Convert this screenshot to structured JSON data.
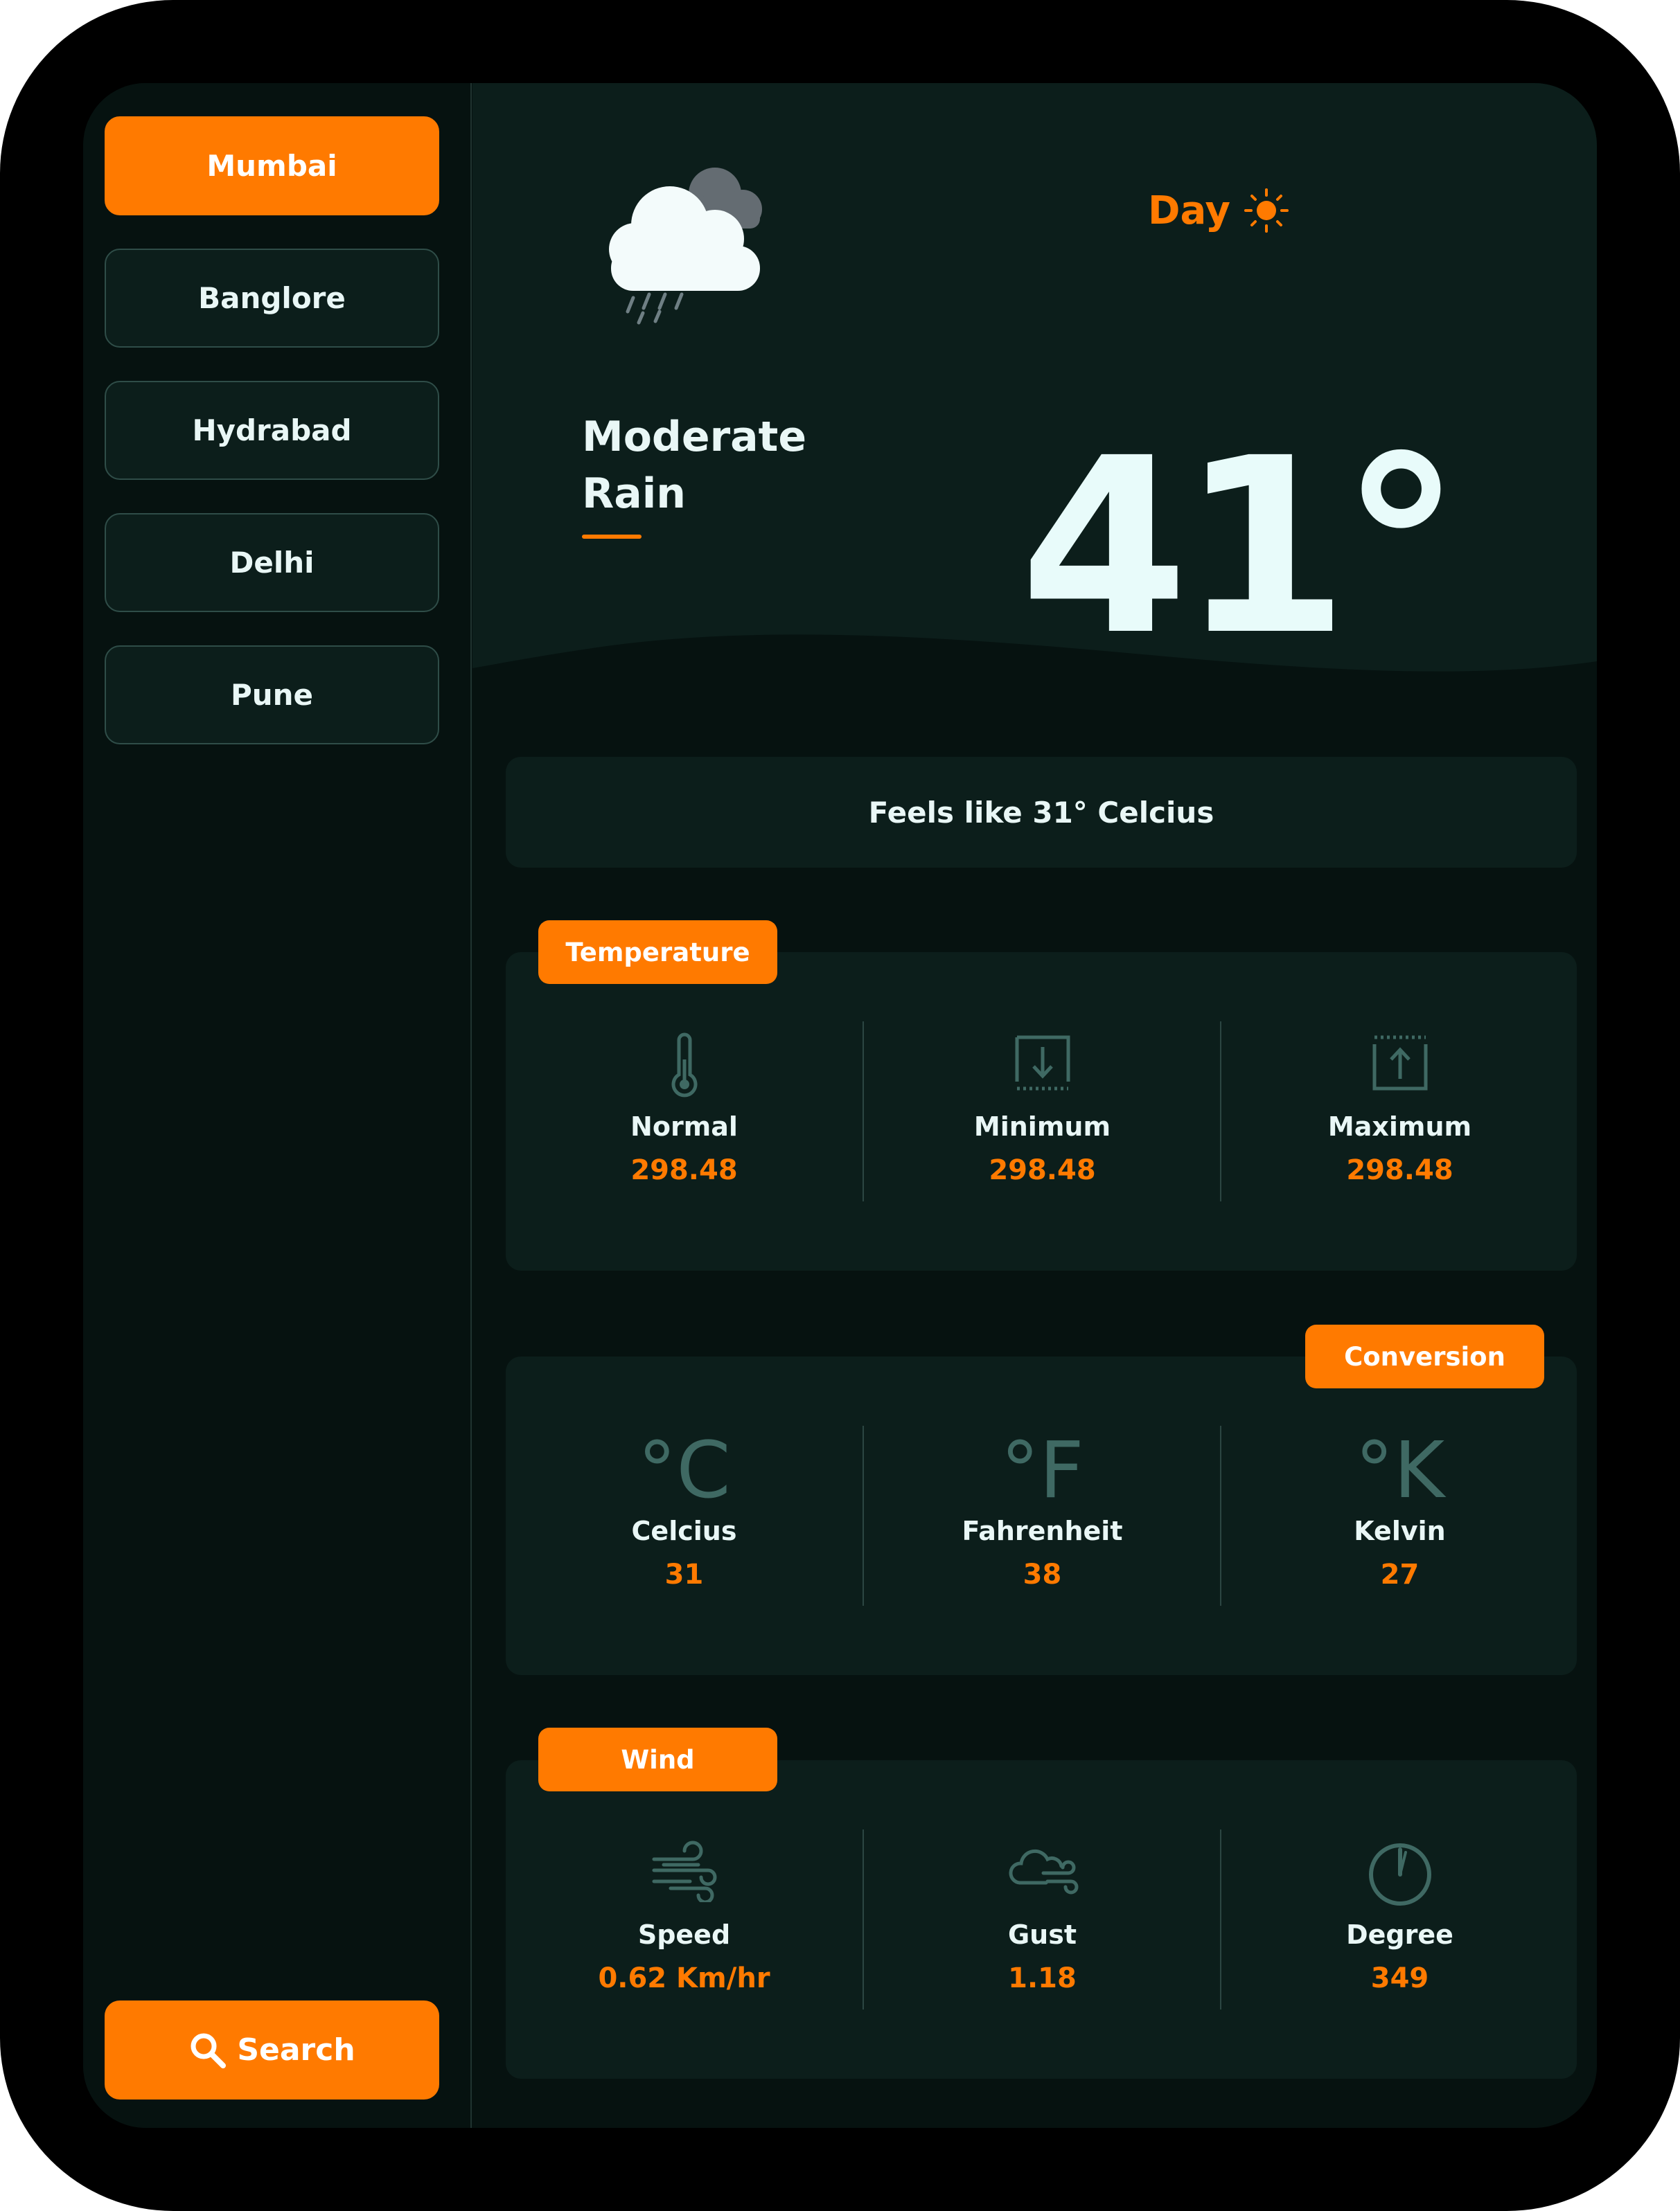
{
  "sidebar": {
    "cities": [
      "Mumbai",
      "Banglore",
      "Hydrabad",
      "Delhi",
      "Pune"
    ],
    "active_city": "Mumbai",
    "search_label": "Search"
  },
  "hero": {
    "period": "Day",
    "condition_line1": "Moderate",
    "condition_line2": "Rain",
    "temperature": "41°",
    "icons": {
      "weather": "cloud-rain-icon",
      "period": "sun-icon"
    }
  },
  "feels_like": "Feels like 31° Celcius",
  "temperature_panel": {
    "tag": "Temperature",
    "items": [
      {
        "label": "Normal",
        "value": "298.48",
        "icon": "thermometer-icon"
      },
      {
        "label": "Minimum",
        "value": "298.48",
        "icon": "min-arrow-icon"
      },
      {
        "label": "Maximum",
        "value": "298.48",
        "icon": "max-arrow-icon"
      }
    ]
  },
  "conversion_panel": {
    "tag": "Conversion",
    "items": [
      {
        "label": "Celcius",
        "value": "31",
        "glyph": "°C"
      },
      {
        "label": "Fahrenheit",
        "value": "38",
        "glyph": "°F"
      },
      {
        "label": "Kelvin",
        "value": "27",
        "glyph": "°K"
      }
    ]
  },
  "wind_panel": {
    "tag": "Wind",
    "items": [
      {
        "label": "Speed",
        "value": "0.62 Km/hr",
        "icon": "wind-icon"
      },
      {
        "label": "Gust",
        "value": "1.18",
        "icon": "gust-icon"
      },
      {
        "label": "Degree",
        "value": "349",
        "icon": "gauge-icon"
      }
    ]
  },
  "colors": {
    "accent": "#ff7a00",
    "background": "#061210",
    "card": "#0c1e1b",
    "text": "#e9f7f6",
    "icon": "#3f6963"
  }
}
